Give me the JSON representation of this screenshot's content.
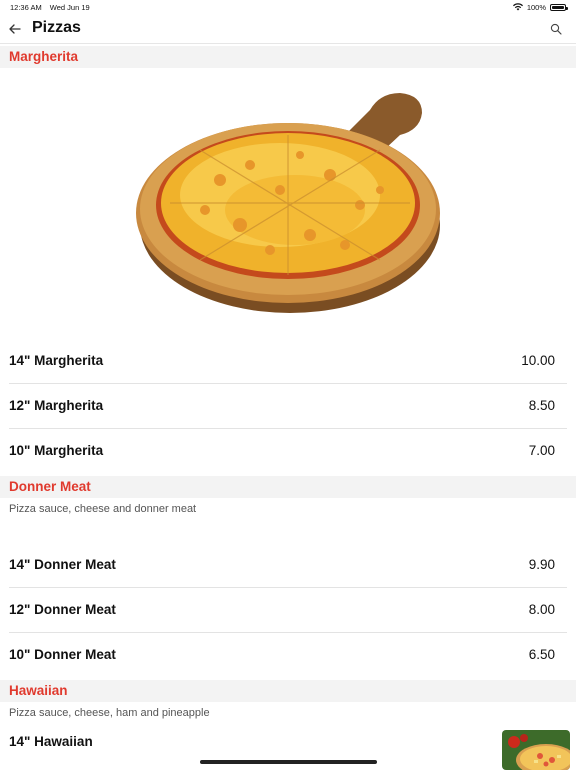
{
  "status_bar": {
    "time": "12:36 AM",
    "date": "Wed Jun 19",
    "battery": "100%"
  },
  "nav": {
    "title": "Pizzas",
    "back_icon": "arrow-left-icon",
    "search_icon": "search-icon"
  },
  "sections": [
    {
      "title": "Margherita",
      "description": "",
      "items": [
        {
          "name": "14\" Margherita",
          "price": "10.00"
        },
        {
          "name": "12\" Margherita",
          "price": "8.50"
        },
        {
          "name": "10\" Margherita",
          "price": "7.00"
        }
      ]
    },
    {
      "title": "Donner Meat",
      "description": "Pizza sauce, cheese and donner meat",
      "items": [
        {
          "name": "14\" Donner Meat",
          "price": "9.90"
        },
        {
          "name": "12\" Donner Meat",
          "price": "8.00"
        },
        {
          "name": "10\" Donner Meat",
          "price": "6.50"
        }
      ]
    },
    {
      "title": "Hawaiian",
      "description": "Pizza sauce, cheese, ham and pineapple",
      "items": [
        {
          "name": "14\" Hawaiian",
          "price": ""
        }
      ]
    }
  ],
  "colors": {
    "accent": "#e03a2e",
    "section_bg": "#f3f3f3",
    "divider": "#e3e3e3"
  }
}
